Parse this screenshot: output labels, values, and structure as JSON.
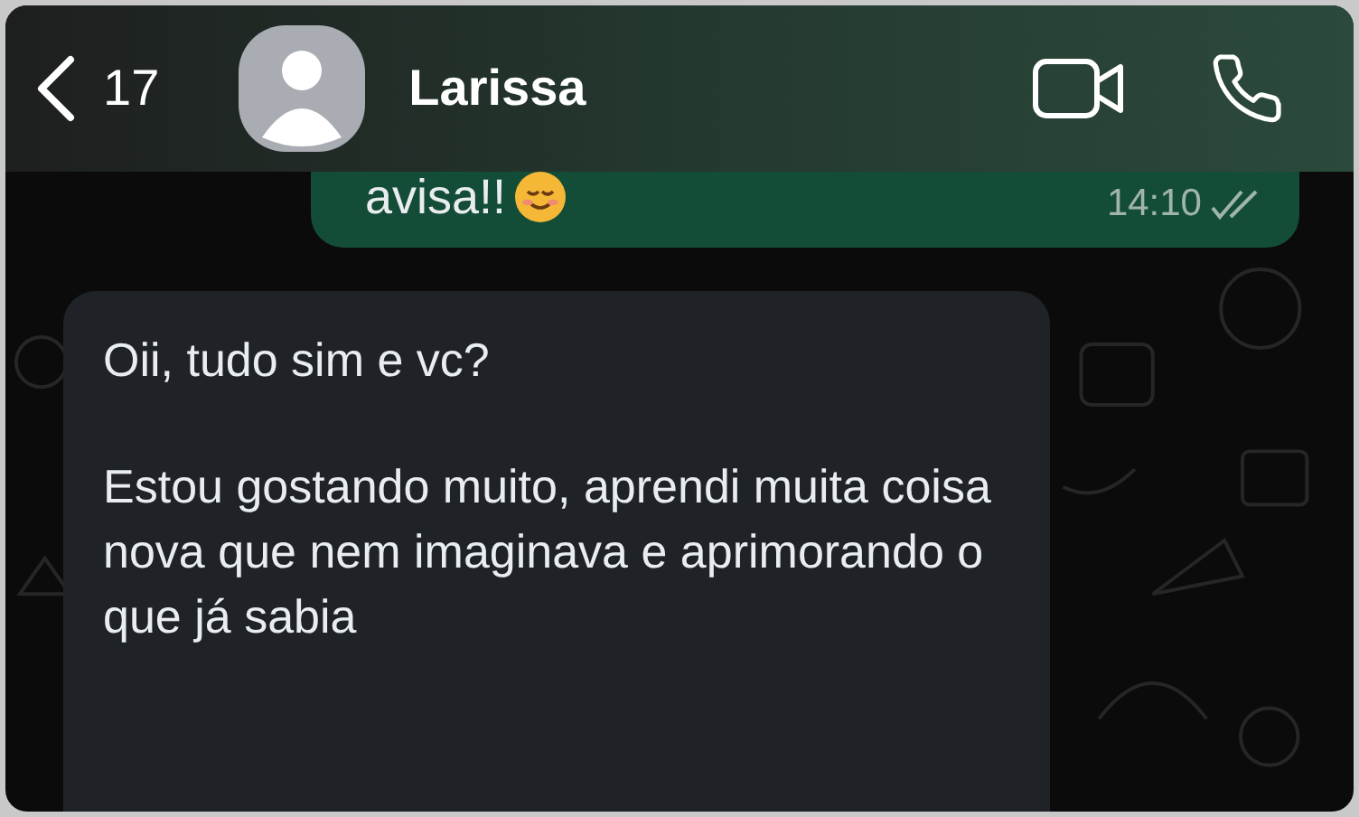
{
  "header": {
    "back_count": "17",
    "contact_name": "Larissa"
  },
  "messages": [
    {
      "kind": "sent",
      "text": "avisa!!",
      "time": "14:10",
      "read": false
    },
    {
      "kind": "received",
      "paragraphs": [
        "Oii, tudo sim e vc?",
        "Estou gostando muito, aprendi muita coisa nova que nem imaginava e aprimorando o que já sabia"
      ]
    }
  ]
}
